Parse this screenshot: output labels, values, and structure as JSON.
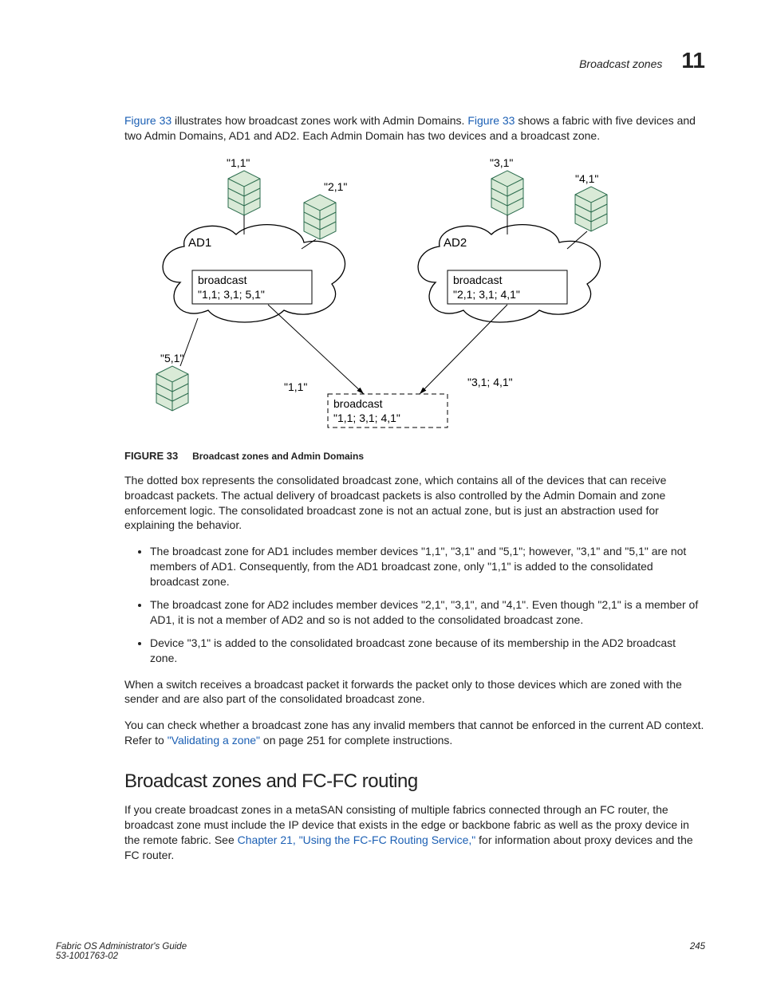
{
  "header": {
    "section": "Broadcast zones",
    "chapter": "11"
  },
  "intro": {
    "link1": "Figure 33",
    "t1a": " illustrates how broadcast zones work with Admin Domains. ",
    "link2": "Figure 33",
    "t1b": " shows a fabric with five devices and two Admin Domains, AD1 and AD2. Each Admin Domain has two devices and a broadcast zone."
  },
  "diagram": {
    "n1": "\"1,1\"",
    "n2": "\"2,1\"",
    "n3": "\"3,1\"",
    "n4": "\"4,1\"",
    "n5": "\"5,1\"",
    "ad1": "AD1",
    "ad2": "AD2",
    "b1a": "broadcast",
    "b1b": "\"1,1;   3,1;   5,1\"",
    "b2a": "broadcast",
    "b2b": "\"2,1;   3,1;   4,1\"",
    "lblL": "\"1,1\"",
    "lblR": "\"3,1;   4,1\"",
    "cba": "broadcast",
    "cbb": "\"1,1;   3,1;   4,1\""
  },
  "figcap": {
    "label": "FIGURE 33",
    "text": "Broadcast zones and Admin Domains"
  },
  "para2": "The dotted box represents the consolidated broadcast zone, which contains all of the devices that can receive broadcast packets. The actual delivery of broadcast packets is also controlled by the Admin Domain and zone enforcement logic. The consolidated broadcast zone is not an actual zone, but is just an abstraction used for explaining the behavior.",
  "bullets": [
    "The broadcast zone for AD1 includes member devices \"1,1\", \"3,1\" and \"5,1\"; however, \"3,1\" and \"5,1\" are not members of AD1. Consequently, from the AD1 broadcast zone, only \"1,1\" is added to the consolidated broadcast zone.",
    "The broadcast zone for AD2 includes member devices \"2,1\", \"3,1\", and \"4,1\". Even though \"2,1\" is a member of AD1, it is not a member of AD2 and so is not added to the consolidated broadcast zone.",
    "Device \"3,1\" is added to the consolidated broadcast zone because of its membership in the AD2 broadcast zone."
  ],
  "para3": "When a switch receives a broadcast packet it forwards the packet only to those devices which are zoned with the sender and are also part of the consolidated broadcast zone.",
  "para4a": "You can check whether a broadcast zone has any invalid members that cannot be enforced in the current AD context. Refer to ",
  "para4link": "\"Validating a zone\"",
  "para4b": " on page 251 for complete instructions.",
  "section2": {
    "title": "Broadcast zones and FC-FC routing"
  },
  "para5a": "If you create broadcast zones in a metaSAN consisting of multiple fabrics connected through an FC router, the broadcast zone must include the IP device that exists in the edge or backbone fabric as well as the proxy device in the remote fabric. See ",
  "para5link": "Chapter 21, \"Using the FC-FC Routing Service,\"",
  "para5b": " for information about proxy devices and the FC router.",
  "footer": {
    "left1": "Fabric OS Administrator's Guide",
    "left2": "53-1001763-02",
    "right": "245"
  }
}
